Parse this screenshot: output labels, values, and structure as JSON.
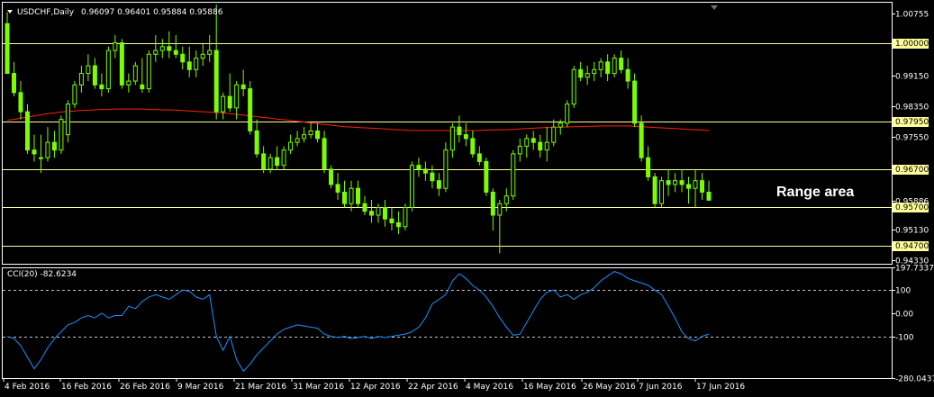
{
  "chart_data": [
    {
      "type": "candlestick",
      "title": "USDCHF,Daily",
      "ohlc_label": "0.96097 0.96401 0.95884 0.95886",
      "ylim": [
        0.9423,
        1.01
      ],
      "y_tick_labels": [
        {
          "value": 1.00755,
          "label": "1.00755"
        },
        {
          "value": 0.9915,
          "label": "0.99150"
        },
        {
          "value": 0.9835,
          "label": "0.98350"
        },
        {
          "value": 0.9755,
          "label": "0.97550"
        },
        {
          "value": 0.95886,
          "label": "0.95886"
        },
        {
          "value": 0.9513,
          "label": "0.95130"
        },
        {
          "value": 0.9433,
          "label": "0.94330"
        }
      ],
      "horizontal_levels": [
        {
          "value": 1.0,
          "label": "1.00000",
          "color": "#FFFF99"
        },
        {
          "value": 0.9795,
          "label": "0.97950",
          "color": "#FFFF99"
        },
        {
          "value": 0.967,
          "label": "0.96700",
          "color": "#FFFF99"
        },
        {
          "value": 0.957,
          "label": "0.95700",
          "color": "#FFFF99"
        },
        {
          "value": 0.947,
          "label": "0.94700",
          "color": "#FFFF99"
        }
      ],
      "annotation": "Range area",
      "candle_color": "#7CFC00",
      "moving_average_color": "#FF2200",
      "candles_ohlc": [
        [
          1.005,
          1.008,
          0.997,
          0.992
        ],
        [
          0.992,
          0.995,
          0.986,
          0.987
        ],
        [
          0.987,
          0.99,
          0.98,
          0.982
        ],
        [
          0.982,
          0.984,
          0.971,
          0.972
        ],
        [
          0.972,
          0.976,
          0.969,
          0.971
        ],
        [
          0.97,
          0.976,
          0.966,
          0.97
        ],
        [
          0.97,
          0.978,
          0.969,
          0.974
        ],
        [
          0.974,
          0.977,
          0.97,
          0.972
        ],
        [
          0.972,
          0.981,
          0.971,
          0.98
        ],
        [
          0.976,
          0.985,
          0.974,
          0.984
        ],
        [
          0.984,
          0.99,
          0.983,
          0.989
        ],
        [
          0.989,
          0.994,
          0.987,
          0.992
        ],
        [
          0.992,
          0.997,
          0.99,
          0.994
        ],
        [
          0.994,
          0.996,
          0.988,
          0.989
        ],
        [
          0.989,
          0.992,
          0.986,
          0.988
        ],
        [
          0.988,
          0.999,
          0.987,
          0.998
        ],
        [
          0.998,
          1.002,
          0.996,
          1.0
        ],
        [
          1.0,
          1.001,
          0.988,
          0.989
        ],
        [
          0.989,
          0.992,
          0.987,
          0.99
        ],
        [
          0.99,
          0.995,
          0.989,
          0.994
        ],
        [
          0.989,
          0.996,
          0.987,
          0.988
        ],
        [
          0.988,
          0.998,
          0.987,
          0.997
        ],
        [
          0.997,
          1.002,
          0.995,
          0.998
        ],
        [
          0.998,
          1.001,
          0.996,
          0.999
        ],
        [
          0.999,
          1.003,
          0.996,
          0.998
        ],
        [
          0.998,
          1.002,
          0.996,
          0.997
        ],
        [
          0.997,
          0.999,
          0.993,
          0.995
        ],
        [
          0.995,
          0.999,
          0.991,
          0.993
        ],
        [
          0.993,
          0.998,
          0.991,
          0.996
        ],
        [
          0.996,
          1.0,
          0.994,
          0.997
        ],
        [
          0.997,
          1.002,
          0.995,
          0.998
        ],
        [
          0.998,
          1.01,
          0.98,
          0.982
        ],
        [
          0.982,
          0.987,
          0.98,
          0.986
        ],
        [
          0.986,
          0.992,
          0.982,
          0.983
        ],
        [
          0.983,
          0.99,
          0.98,
          0.989
        ],
        [
          0.989,
          0.993,
          0.986,
          0.988
        ],
        [
          0.988,
          0.99,
          0.976,
          0.977
        ],
        [
          0.977,
          0.98,
          0.97,
          0.971
        ],
        [
          0.971,
          0.973,
          0.966,
          0.967
        ],
        [
          0.967,
          0.971,
          0.966,
          0.97
        ],
        [
          0.97,
          0.973,
          0.967,
          0.968
        ],
        [
          0.968,
          0.973,
          0.967,
          0.972
        ],
        [
          0.972,
          0.976,
          0.971,
          0.974
        ],
        [
          0.974,
          0.977,
          0.973,
          0.975
        ],
        [
          0.975,
          0.978,
          0.974,
          0.976
        ],
        [
          0.976,
          0.979,
          0.975,
          0.977
        ],
        [
          0.977,
          0.979,
          0.974,
          0.975
        ],
        [
          0.975,
          0.977,
          0.966,
          0.967
        ],
        [
          0.967,
          0.968,
          0.962,
          0.963
        ],
        [
          0.963,
          0.966,
          0.959,
          0.961
        ],
        [
          0.961,
          0.964,
          0.957,
          0.958
        ],
        [
          0.958,
          0.964,
          0.956,
          0.962
        ],
        [
          0.962,
          0.964,
          0.957,
          0.958
        ],
        [
          0.958,
          0.96,
          0.955,
          0.956
        ],
        [
          0.956,
          0.959,
          0.953,
          0.955
        ],
        [
          0.955,
          0.958,
          0.953,
          0.957
        ],
        [
          0.957,
          0.959,
          0.952,
          0.954
        ],
        [
          0.954,
          0.957,
          0.951,
          0.953
        ],
        [
          0.953,
          0.956,
          0.95,
          0.952
        ],
        [
          0.952,
          0.958,
          0.951,
          0.957
        ],
        [
          0.957,
          0.969,
          0.956,
          0.968
        ],
        [
          0.968,
          0.97,
          0.965,
          0.967
        ],
        [
          0.967,
          0.969,
          0.964,
          0.966
        ],
        [
          0.966,
          0.968,
          0.962,
          0.964
        ],
        [
          0.964,
          0.966,
          0.96,
          0.962
        ],
        [
          0.962,
          0.974,
          0.961,
          0.972
        ],
        [
          0.972,
          0.979,
          0.97,
          0.978
        ],
        [
          0.978,
          0.981,
          0.974,
          0.976
        ],
        [
          0.976,
          0.979,
          0.973,
          0.975
        ],
        [
          0.975,
          0.977,
          0.97,
          0.971
        ],
        [
          0.971,
          0.973,
          0.968,
          0.969
        ],
        [
          0.969,
          0.97,
          0.96,
          0.961
        ],
        [
          0.961,
          0.962,
          0.951,
          0.955
        ],
        [
          0.955,
          0.959,
          0.945,
          0.958
        ],
        [
          0.958,
          0.962,
          0.956,
          0.96
        ],
        [
          0.96,
          0.972,
          0.959,
          0.971
        ],
        [
          0.971,
          0.975,
          0.969,
          0.973
        ],
        [
          0.973,
          0.976,
          0.97,
          0.975
        ],
        [
          0.975,
          0.977,
          0.972,
          0.974
        ],
        [
          0.974,
          0.976,
          0.97,
          0.972
        ],
        [
          0.972,
          0.978,
          0.969,
          0.974
        ],
        [
          0.974,
          0.98,
          0.973,
          0.978
        ],
        [
          0.978,
          0.98,
          0.976,
          0.979
        ],
        [
          0.979,
          0.985,
          0.978,
          0.984
        ],
        [
          0.984,
          0.994,
          0.983,
          0.993
        ],
        [
          0.993,
          0.995,
          0.99,
          0.991
        ],
        [
          0.991,
          0.994,
          0.989,
          0.992
        ],
        [
          0.992,
          0.995,
          0.99,
          0.993
        ],
        [
          0.993,
          0.996,
          0.991,
          0.995
        ],
        [
          0.995,
          0.997,
          0.99,
          0.992
        ],
        [
          0.992,
          0.997,
          0.991,
          0.996
        ],
        [
          0.996,
          0.998,
          0.992,
          0.993
        ],
        [
          0.993,
          0.996,
          0.988,
          0.99
        ],
        [
          0.99,
          0.992,
          0.978,
          0.979
        ],
        [
          0.979,
          0.981,
          0.969,
          0.97
        ],
        [
          0.97,
          0.973,
          0.964,
          0.965
        ],
        [
          0.965,
          0.966,
          0.957,
          0.958
        ],
        [
          0.958,
          0.965,
          0.957,
          0.964
        ],
        [
          0.964,
          0.967,
          0.96,
          0.963
        ],
        [
          0.963,
          0.966,
          0.961,
          0.964
        ],
        [
          0.964,
          0.967,
          0.961,
          0.963
        ],
        [
          0.963,
          0.965,
          0.958,
          0.962
        ],
        [
          0.962,
          0.967,
          0.957,
          0.964
        ],
        [
          0.964,
          0.966,
          0.959,
          0.961
        ],
        [
          0.961,
          0.964,
          0.9588,
          0.9589
        ]
      ],
      "moving_average": [
        0.9798,
        0.98,
        0.9803,
        0.9806,
        0.9809,
        0.9812,
        0.9815,
        0.9817,
        0.9819,
        0.9821,
        0.9822,
        0.9823,
        0.9824,
        0.9825,
        0.9826,
        0.9826,
        0.9827,
        0.9827,
        0.9827,
        0.9827,
        0.9827,
        0.9826,
        0.9826,
        0.9825,
        0.9825,
        0.9824,
        0.9823,
        0.9822,
        0.9821,
        0.982,
        0.9819,
        0.9818,
        0.9817,
        0.9815,
        0.9813,
        0.9811,
        0.9809,
        0.9807,
        0.9805,
        0.9803,
        0.9801,
        0.9799,
        0.9797,
        0.9795,
        0.9793,
        0.9791,
        0.9789,
        0.9787,
        0.9785,
        0.9783,
        0.9781,
        0.978,
        0.9779,
        0.9778,
        0.9777,
        0.9776,
        0.9775,
        0.9774,
        0.9773,
        0.9772,
        0.9771,
        0.9771,
        0.9771,
        0.9771,
        0.9771,
        0.9771,
        0.9771,
        0.9771,
        0.9771,
        0.9771,
        0.9771,
        0.9772,
        0.9772,
        0.9773,
        0.9773,
        0.9774,
        0.9775,
        0.9776,
        0.9777,
        0.9778,
        0.9779,
        0.9779,
        0.978,
        0.978,
        0.9781,
        0.9781,
        0.9782,
        0.9782,
        0.9783,
        0.9783,
        0.9783,
        0.9783,
        0.9783,
        0.9782,
        0.9781,
        0.978,
        0.9779,
        0.9778,
        0.9777,
        0.9776,
        0.9775,
        0.9774,
        0.9773,
        0.9772,
        0.9771
      ],
      "x_tick_labels": [
        "4 Feb 2016",
        "16 Feb 2016",
        "26 Feb 2016",
        "9 Mar 2016",
        "21 Mar 2016",
        "31 Mar 2016",
        "12 Apr 2016",
        "22 Apr 2016",
        "4 May 2016",
        "16 May 2016",
        "26 May 2016",
        "7 Jun 2016",
        "17 Jun 2016"
      ]
    },
    {
      "type": "line",
      "title": "CCI(20) -82.6234",
      "ylim": [
        -280.0437,
        197.7337
      ],
      "y_tick_labels": [
        {
          "value": 197.7337,
          "label": "197.7337"
        },
        {
          "value": 100,
          "label": "100"
        },
        {
          "value": 0,
          "label": "0.00"
        },
        {
          "value": -100,
          "label": "-100"
        },
        {
          "value": -280.0437,
          "label": "-280.0437"
        }
      ],
      "levels": [
        100,
        -100
      ],
      "line_color": "#1E90FF",
      "values": [
        -100,
        -110,
        -140,
        -190,
        -240,
        -200,
        -150,
        -110,
        -80,
        -50,
        -40,
        -20,
        -10,
        -20,
        0,
        -20,
        -10,
        -10,
        30,
        20,
        50,
        70,
        80,
        70,
        60,
        80,
        100,
        95,
        70,
        60,
        80,
        -100,
        -160,
        -100,
        -200,
        -250,
        -220,
        -180,
        -150,
        -120,
        -90,
        -70,
        -60,
        -50,
        -55,
        -60,
        -65,
        -90,
        -100,
        -105,
        -100,
        -110,
        -105,
        -100,
        -110,
        -100,
        -105,
        -100,
        -95,
        -90,
        -80,
        -60,
        -20,
        40,
        60,
        80,
        140,
        170,
        150,
        120,
        100,
        70,
        30,
        -20,
        -60,
        -95,
        -90,
        -40,
        10,
        60,
        90,
        100,
        70,
        80,
        60,
        80,
        90,
        110,
        140,
        160,
        180,
        170,
        150,
        140,
        130,
        120,
        100,
        80,
        30,
        -20,
        -80,
        -110,
        -120,
        -100,
        -90
      ]
    }
  ]
}
